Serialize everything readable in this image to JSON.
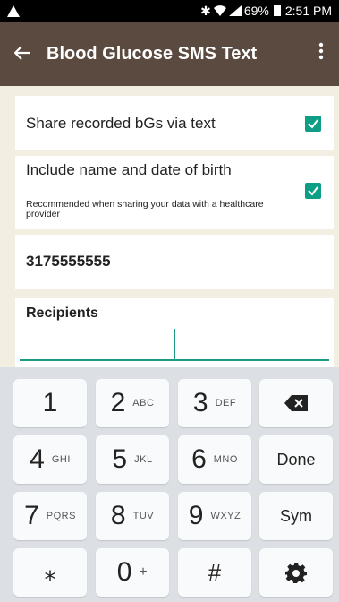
{
  "status_bar": {
    "battery": "69%",
    "time": "2:51 PM"
  },
  "app_bar": {
    "title": "Blood Glucose SMS Text"
  },
  "settings": {
    "share_label": "Share recorded bGs via text",
    "share_checked": true,
    "include_label": "Include name and date of birth",
    "include_sublabel": "Recommended when sharing your data with a healthcare provider",
    "include_checked": true,
    "phone_value": "3175555555",
    "recipients_label": "Recipients",
    "recipients_value": ""
  },
  "keyboard": {
    "rows": [
      [
        {
          "main": "1",
          "sub": ""
        },
        {
          "main": "2",
          "sub": "ABC"
        },
        {
          "main": "3",
          "sub": "DEF"
        },
        {
          "main": "",
          "sub": "",
          "icon": "backspace-icon"
        }
      ],
      [
        {
          "main": "4",
          "sub": "GHI"
        },
        {
          "main": "5",
          "sub": "JKL"
        },
        {
          "main": "6",
          "sub": "MNO"
        },
        {
          "main": "Done",
          "sub": ""
        }
      ],
      [
        {
          "main": "7",
          "sub": "PQRS"
        },
        {
          "main": "8",
          "sub": "TUV"
        },
        {
          "main": "9",
          "sub": "WXYZ"
        },
        {
          "main": "Sym",
          "sub": ""
        }
      ],
      [
        {
          "main": "⁎",
          "sub": ""
        },
        {
          "main": "0",
          "sub": "+"
        },
        {
          "main": "#",
          "sub": ""
        },
        {
          "main": "",
          "sub": "",
          "icon": "gear-icon"
        }
      ]
    ]
  },
  "colors": {
    "app_bar": "#5b4a40",
    "accent": "#0e9e86",
    "background": "#f2eee2"
  }
}
